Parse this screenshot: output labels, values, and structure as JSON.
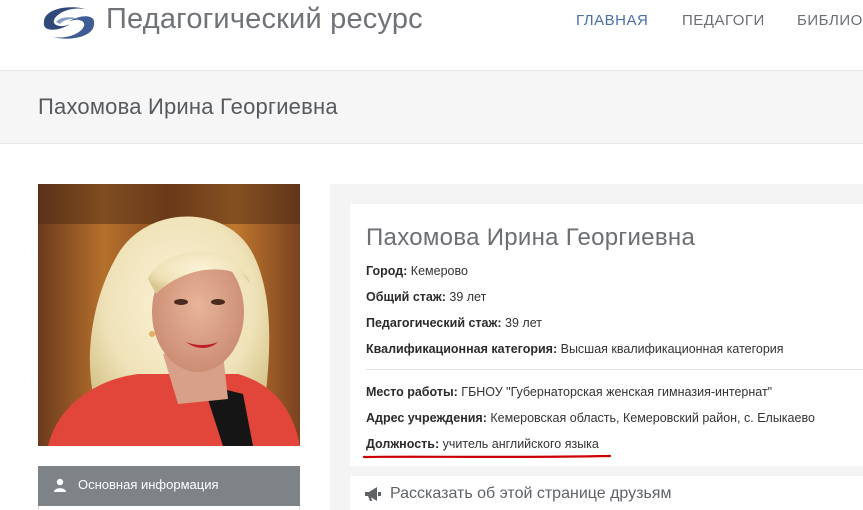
{
  "site": {
    "brand": "Педагогический ресурс",
    "nav": [
      {
        "label": "ГЛАВНАЯ",
        "active": true
      },
      {
        "label": "ПЕДАГОГИ",
        "active": false
      },
      {
        "label": "БИБЛИОТ",
        "active": false
      }
    ]
  },
  "page": {
    "title": "Пахомова Ирина Георгиевна"
  },
  "sidebar": {
    "menu_item": "Основная информация",
    "menu_icon": "user-icon"
  },
  "profile": {
    "name": "Пахомова Ирина Георгиевна",
    "fields": [
      {
        "label": "Город:",
        "value": "Кемерово"
      },
      {
        "label": "Общий стаж:",
        "value": "39 лет"
      },
      {
        "label": "Педагогический стаж:",
        "value": "39 лет"
      },
      {
        "label": "Квалификационная категория:",
        "value": "Высшая квалификационная категория"
      },
      {
        "label": "Место работы:",
        "value": "ГБНОУ \"Губернаторская женская гимназия-интернат\""
      },
      {
        "label": "Адрес учреждения:",
        "value": "Кемеровская область, Кемеровский район, с. Елыкаево"
      },
      {
        "label": "Должность:",
        "value": "учитель английского языка"
      }
    ]
  },
  "share": {
    "label": "Рассказать об этой странице друзьям",
    "icon": "megaphone-icon"
  },
  "colors": {
    "nav_active": "#4a6fa5",
    "sidebar_menu_bg": "#7d8387",
    "underline": "#cc0000"
  }
}
